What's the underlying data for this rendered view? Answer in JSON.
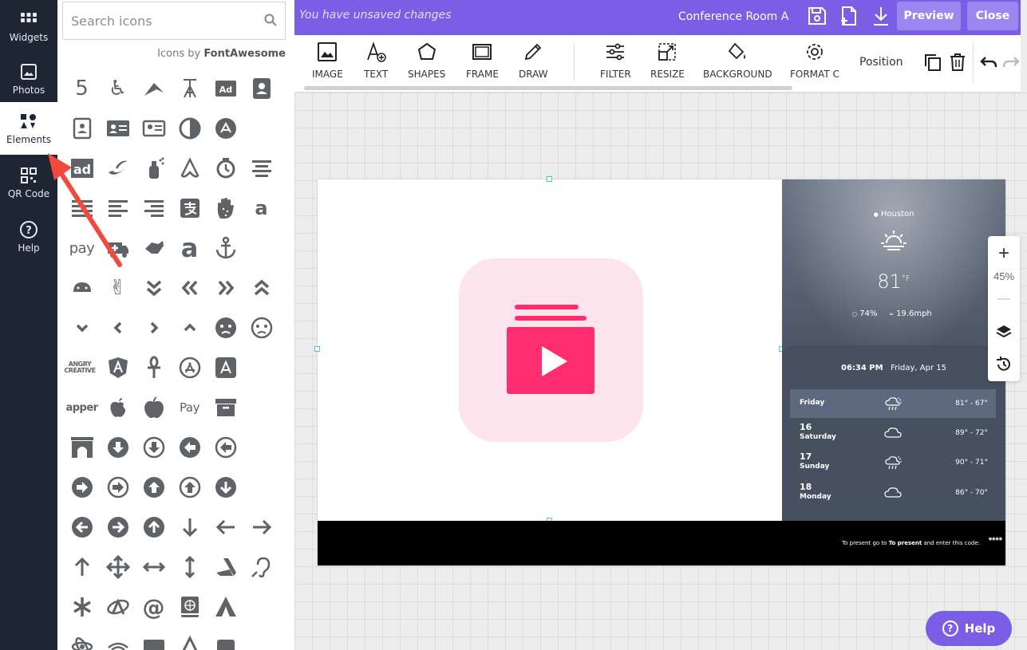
{
  "rail": {
    "items": [
      {
        "label": "Widgets",
        "icon": "widgets-icon"
      },
      {
        "label": "Photos",
        "icon": "photos-icon"
      },
      {
        "label": "Elements",
        "icon": "elements-icon",
        "active": true
      },
      {
        "label": "QR Code",
        "icon": "qr-code-icon"
      },
      {
        "label": "Help",
        "icon": "help-circle-icon"
      }
    ]
  },
  "icon_panel": {
    "search_placeholder": "Search icons",
    "credit_prefix": "Icons by",
    "credit_brand": "FontAwesome",
    "text_icons": {
      "pay": "pay",
      "ad": "ad",
      "apper": "apper",
      "applepay": " Pay",
      "angry": "ANGRY CREATIVE",
      "adbox": "Ad"
    }
  },
  "topbar": {
    "status": "You have unsaved changes",
    "room": "Conference Room A",
    "preview_label": "Preview",
    "close_label": "Close"
  },
  "toolbar": {
    "tools": [
      {
        "label": "IMAGE"
      },
      {
        "label": "TEXT"
      },
      {
        "label": "SHAPES"
      },
      {
        "label": "FRAME"
      },
      {
        "label": "DRAW"
      },
      {
        "label": "FILTER"
      },
      {
        "label": "RESIZE"
      },
      {
        "label": "BACKGROUND"
      },
      {
        "label": "FORMAT C"
      }
    ],
    "position_label": "Position"
  },
  "weather": {
    "city": "Houston",
    "temp": "81",
    "unit": "°F",
    "humidity": "74%",
    "wind": "19.6mph",
    "time": "06:34 PM",
    "date": "Friday, Apr 15",
    "forecast": [
      {
        "day": "Friday",
        "num": "",
        "range": "81° - 67°",
        "icon": "rain-sun-icon"
      },
      {
        "day": "Saturday",
        "num": "16",
        "range": "89° - 72°",
        "icon": "cloud-icon"
      },
      {
        "day": "Sunday",
        "num": "17",
        "range": "90° - 71°",
        "icon": "rain-sun-icon"
      },
      {
        "day": "Monday",
        "num": "18",
        "range": "86° - 70°",
        "icon": "cloud-icon"
      }
    ]
  },
  "slide": {
    "present_text_a": "To present go to ",
    "present_text_b": "To present",
    "present_text_c": " and enter this code:",
    "code": "****"
  },
  "zoom": {
    "level": "45%",
    "plus": "+",
    "minus": "—"
  },
  "help_fab": {
    "label": "Help",
    "mark": "?"
  },
  "colors": {
    "accent": "#7b5ee6",
    "rail": "#1f2633",
    "pink": "#ff2d6f",
    "pink_bg": "#fde4ec"
  }
}
